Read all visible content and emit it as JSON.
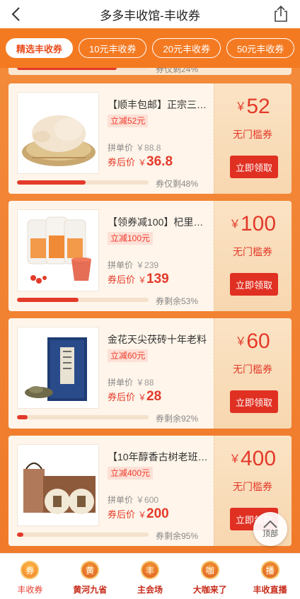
{
  "header": {
    "title": "多多丰收馆-丰收券",
    "back_icon": "back-arrow-icon",
    "share_icon": "share-icon"
  },
  "tabs": [
    {
      "label": "精选丰收券",
      "active": true
    },
    {
      "label": "10元丰收券",
      "active": false
    },
    {
      "label": "20元丰收券",
      "active": false
    },
    {
      "label": "50元丰收券",
      "active": false
    }
  ],
  "partial_card": {
    "remain": "券仅剩24%",
    "progress_pct": 76
  },
  "cards": [
    {
      "name": "【顺丰包邮】正宗三…",
      "discount": "立减52元",
      "orig_label": "拼单价",
      "orig_price": "￥88.8",
      "after_label": "券后价",
      "yen": "￥",
      "after_price": "36.8",
      "remain": "券仅剩48%",
      "progress_pct": 52,
      "amount": "52",
      "condition": "无门槛券",
      "claim": "立即领取",
      "image": "chicken"
    },
    {
      "name": "【领券减100】杞里…",
      "discount": "立减100元",
      "orig_label": "拼单价",
      "orig_price": "￥239",
      "after_label": "券后价",
      "yen": "￥",
      "after_price": "139",
      "remain": "券剩余53%",
      "progress_pct": 47,
      "amount": "100",
      "condition": "无门槛券",
      "claim": "立即领取",
      "image": "juice"
    },
    {
      "name": "金花天尖茯砖十年老料",
      "discount": "立减60元",
      "orig_label": "拼单价",
      "orig_price": "￥88",
      "after_label": "券后价",
      "yen": "￥",
      "after_price": "28",
      "remain": "券剩余92%",
      "progress_pct": 8,
      "amount": "60",
      "condition": "无门槛券",
      "claim": "立即领取",
      "image": "tea-box"
    },
    {
      "name": "【10年醇香古树老班…",
      "discount": "立减400元",
      "orig_label": "拼单价",
      "orig_price": "￥600",
      "after_label": "券后价",
      "yen": "￥",
      "after_price": "200",
      "remain": "券剩余95%",
      "progress_pct": 5,
      "amount": "400",
      "condition": "无门槛券",
      "claim": "立即领取",
      "image": "tea-cakes"
    }
  ],
  "to_top": {
    "label": "顶部",
    "icon": "chevron-up-icon"
  },
  "bottom_nav": [
    {
      "label": "丰收券",
      "glyph": "券",
      "active": true
    },
    {
      "label": "黄河九省",
      "glyph": "黄",
      "active": false
    },
    {
      "label": "主会场",
      "glyph": "丰",
      "active": false
    },
    {
      "label": "大咖来了",
      "glyph": "咖",
      "active": false
    },
    {
      "label": "丰收直播",
      "glyph": "播",
      "active": false
    }
  ],
  "colors": {
    "accent": "#e33a2a",
    "brand_orange": "#f47a22"
  }
}
